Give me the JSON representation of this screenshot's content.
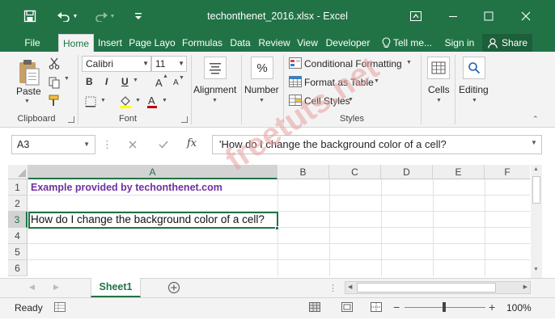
{
  "app": {
    "title": "techonthenet_2016.xlsx - Excel"
  },
  "tabs": [
    "File",
    "Home",
    "Insert",
    "Page Layo",
    "Formulas",
    "Data",
    "Review",
    "View",
    "Developer"
  ],
  "tell_me": "Tell me...",
  "sign_in": "Sign in",
  "share": "Share",
  "ribbon": {
    "clipboard": {
      "paste": "Paste",
      "label": "Clipboard"
    },
    "font": {
      "name": "Calibri",
      "size": "11",
      "bold": "B",
      "italic": "I",
      "underline": "U",
      "grow": "A",
      "shrink": "A",
      "label": "Font"
    },
    "alignment": "Alignment",
    "number": {
      "label": "Number",
      "symbol": "%"
    },
    "styles": {
      "conditional": "Conditional Formatting",
      "table": "Format as Table",
      "cell_styles": "Cell Styles",
      "label": "Styles"
    },
    "cells": "Cells",
    "editing": "Editing"
  },
  "formula_bar": {
    "name_box": "A3",
    "fx": "fx",
    "content": "'How do I change the background color of a cell?"
  },
  "grid": {
    "columns": [
      "A",
      "B",
      "C",
      "D",
      "E",
      "F"
    ],
    "rows": [
      "1",
      "2",
      "3",
      "4",
      "5",
      "6"
    ],
    "a1": "Example provided by techonthenet.com",
    "a3": "How do I change the background color of a cell?"
  },
  "watermark": "freetuts.net",
  "sheet": {
    "name": "Sheet1"
  },
  "status": {
    "text": "Ready",
    "zoom": "100%"
  },
  "colors": {
    "accent": "#217346",
    "a1_text": "#7030a0",
    "watermark": "#e8a0a0"
  }
}
